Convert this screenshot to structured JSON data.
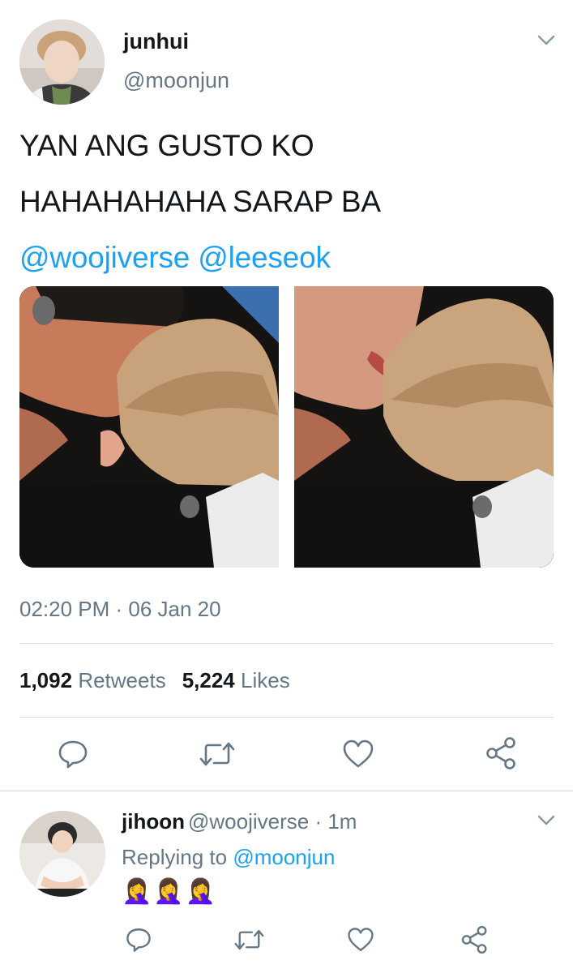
{
  "tweet": {
    "author_name": "junhui",
    "author_handle": "@moonjun",
    "text_line1": "YAN ANG GUSTO KO",
    "text_line2": "HAHAHAHAHA SARAP BA",
    "mention1": "@woojiverse",
    "mention2": "@leeseok",
    "timestamp": "02:20 PM · 06 Jan 20",
    "retweet_count": "1,092",
    "retweet_label": "Retweets",
    "like_count": "5,224",
    "like_label": "Likes"
  },
  "reply": {
    "author_name": "jihoon",
    "author_handle": "@woojiverse · 1m",
    "replying_prefix": "Replying to",
    "replying_handle": "@moonjun",
    "emojis": "🤦‍♀️🤦‍♀️🤦‍♀️"
  },
  "icons": [
    "reply-icon",
    "retweet-icon",
    "like-icon",
    "share-icon",
    "chevron-down-icon"
  ],
  "colors": {
    "link": "#1da1f2",
    "secondary_text": "#657786",
    "primary_text": "#14171a",
    "divider": "#d8dee3"
  }
}
